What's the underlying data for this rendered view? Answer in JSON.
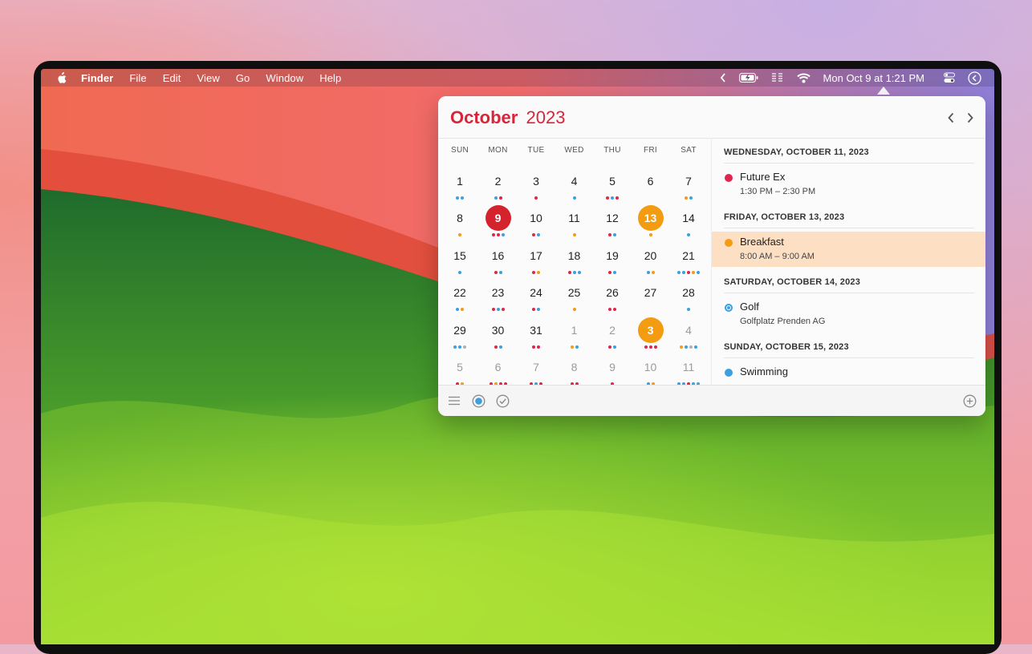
{
  "menubar": {
    "apple_icon": "apple-logo-icon",
    "app_name": "Finder",
    "menus": [
      "File",
      "Edit",
      "View",
      "Go",
      "Window",
      "Help"
    ],
    "clock": "Mon Oct 9 at 1:21 PM",
    "status_icons": [
      "chevron-left-icon",
      "battery-charging-icon",
      "audio-meter-icon",
      "wifi-icon",
      "control-center-icon",
      "siri-icon"
    ]
  },
  "calendar": {
    "month": "October",
    "year": "2023",
    "accent_color": "#d7263a",
    "weekdays": [
      "SUN",
      "MON",
      "TUE",
      "WED",
      "THU",
      "FRI",
      "SAT"
    ],
    "weeks": [
      [
        {
          "d": "1",
          "dots": [
            "#3aa0e2",
            "#3aa0e2"
          ]
        },
        {
          "d": "2",
          "dots": [
            "#3aa0e2",
            "#e0244b"
          ]
        },
        {
          "d": "3",
          "dots": [
            "#e0244b"
          ]
        },
        {
          "d": "4",
          "dots": [
            "#3aa0e2"
          ]
        },
        {
          "d": "5",
          "dots": [
            "#e0244b",
            "#3aa0e2",
            "#e0244b"
          ]
        },
        {
          "d": "6",
          "dots": []
        },
        {
          "d": "7",
          "dots": [
            "#f39c12",
            "#3aa0e2"
          ]
        }
      ],
      [
        {
          "d": "8",
          "dots": [
            "#f39c12"
          ]
        },
        {
          "d": "9",
          "today": true,
          "dots": [
            "#e0244b",
            "#e0244b",
            "#3aa0e2"
          ]
        },
        {
          "d": "10",
          "dots": [
            "#e0244b",
            "#3aa0e2"
          ]
        },
        {
          "d": "11",
          "dots": [
            "#f39c12"
          ]
        },
        {
          "d": "12",
          "dots": [
            "#e0244b",
            "#3aa0e2"
          ]
        },
        {
          "d": "13",
          "selected": true,
          "dots": [
            "#f39c12"
          ]
        },
        {
          "d": "14",
          "dots": [
            "#3aa0e2"
          ]
        }
      ],
      [
        {
          "d": "15",
          "dots": [
            "#3aa0e2"
          ]
        },
        {
          "d": "16",
          "dots": [
            "#e0244b",
            "#3aa0e2"
          ]
        },
        {
          "d": "17",
          "dots": [
            "#e0244b",
            "#f39c12"
          ]
        },
        {
          "d": "18",
          "dots": [
            "#e0244b",
            "#3aa0e2",
            "#3aa0e2"
          ]
        },
        {
          "d": "19",
          "dots": [
            "#e0244b",
            "#3aa0e2"
          ]
        },
        {
          "d": "20",
          "dots": [
            "#3aa0e2",
            "#f39c12"
          ]
        },
        {
          "d": "21",
          "dots": [
            "#3aa0e2",
            "#3aa0e2",
            "#e0244b",
            "#f39c12",
            "#3aa0e2"
          ]
        }
      ],
      [
        {
          "d": "22",
          "dots": [
            "#3aa0e2",
            "#f39c12"
          ]
        },
        {
          "d": "23",
          "dots": [
            "#e0244b",
            "#3aa0e2",
            "#e0244b"
          ]
        },
        {
          "d": "24",
          "dots": [
            "#e0244b",
            "#3aa0e2"
          ]
        },
        {
          "d": "25",
          "dots": [
            "#f39c12"
          ]
        },
        {
          "d": "26",
          "dots": [
            "#e0244b",
            "#e0244b"
          ]
        },
        {
          "d": "27",
          "dots": []
        },
        {
          "d": "28",
          "dots": [
            "#3aa0e2"
          ]
        }
      ],
      [
        {
          "d": "29",
          "dots": [
            "#3aa0e2",
            "#3aa0e2",
            "#b0b0b0"
          ]
        },
        {
          "d": "30",
          "dots": [
            "#e0244b",
            "#3aa0e2"
          ]
        },
        {
          "d": "31",
          "dots": [
            "#e0244b",
            "#e0244b"
          ]
        },
        {
          "d": "1",
          "other": true,
          "dots": [
            "#f39c12",
            "#3aa0e2"
          ]
        },
        {
          "d": "2",
          "other": true,
          "dots": [
            "#e0244b",
            "#3aa0e2"
          ]
        },
        {
          "d": "3",
          "other": true,
          "selected": true,
          "dots": [
            "#e0244b",
            "#e0244b",
            "#e0244b"
          ]
        },
        {
          "d": "4",
          "other": true,
          "dots": [
            "#f39c12",
            "#3aa0e2",
            "#b0b0b0",
            "#3aa0e2"
          ]
        }
      ],
      [
        {
          "d": "5",
          "other": true,
          "dots": [
            "#e0244b",
            "#f39c12"
          ]
        },
        {
          "d": "6",
          "other": true,
          "dots": [
            "#e0244b",
            "#f39c12",
            "#e0244b",
            "#e0244b"
          ]
        },
        {
          "d": "7",
          "other": true,
          "dots": [
            "#e0244b",
            "#3aa0e2",
            "#e0244b"
          ]
        },
        {
          "d": "8",
          "other": true,
          "dots": [
            "#e0244b",
            "#e0244b"
          ]
        },
        {
          "d": "9",
          "other": true,
          "dots": [
            "#e0244b"
          ]
        },
        {
          "d": "10",
          "other": true,
          "dots": [
            "#3aa0e2",
            "#f39c12"
          ]
        },
        {
          "d": "11",
          "other": true,
          "dots": [
            "#3aa0e2",
            "#3aa0e2",
            "#e0244b",
            "#3aa0e2",
            "#3aa0e2"
          ]
        }
      ]
    ]
  },
  "events": [
    {
      "date": "WEDNESDAY, OCTOBER 11, 2023",
      "items": [
        {
          "title": "Future Ex",
          "sub": "1:30 PM – 2:30 PM",
          "color": "#e0244b",
          "highlight": false
        }
      ]
    },
    {
      "date": "FRIDAY, OCTOBER 13, 2023",
      "items": [
        {
          "title": "Breakfast",
          "sub": "8:00 AM – 9:00 AM",
          "color": "#f39c12",
          "highlight": true
        }
      ]
    },
    {
      "date": "SATURDAY, OCTOBER 14, 2023",
      "items": [
        {
          "title": "Golf",
          "sub": "Golfplatz Prenden AG",
          "color": "#3aa0e2",
          "ring": true,
          "highlight": false
        }
      ]
    },
    {
      "date": "SUNDAY, OCTOBER 15, 2023",
      "items": [
        {
          "title": "Swimming",
          "sub": "",
          "color": "#3aa0e2",
          "highlight": false
        }
      ]
    }
  ],
  "footer": {
    "icons": [
      "list-icon",
      "calendar-dot-icon",
      "checkmark-circle-icon",
      "add-icon"
    ]
  }
}
